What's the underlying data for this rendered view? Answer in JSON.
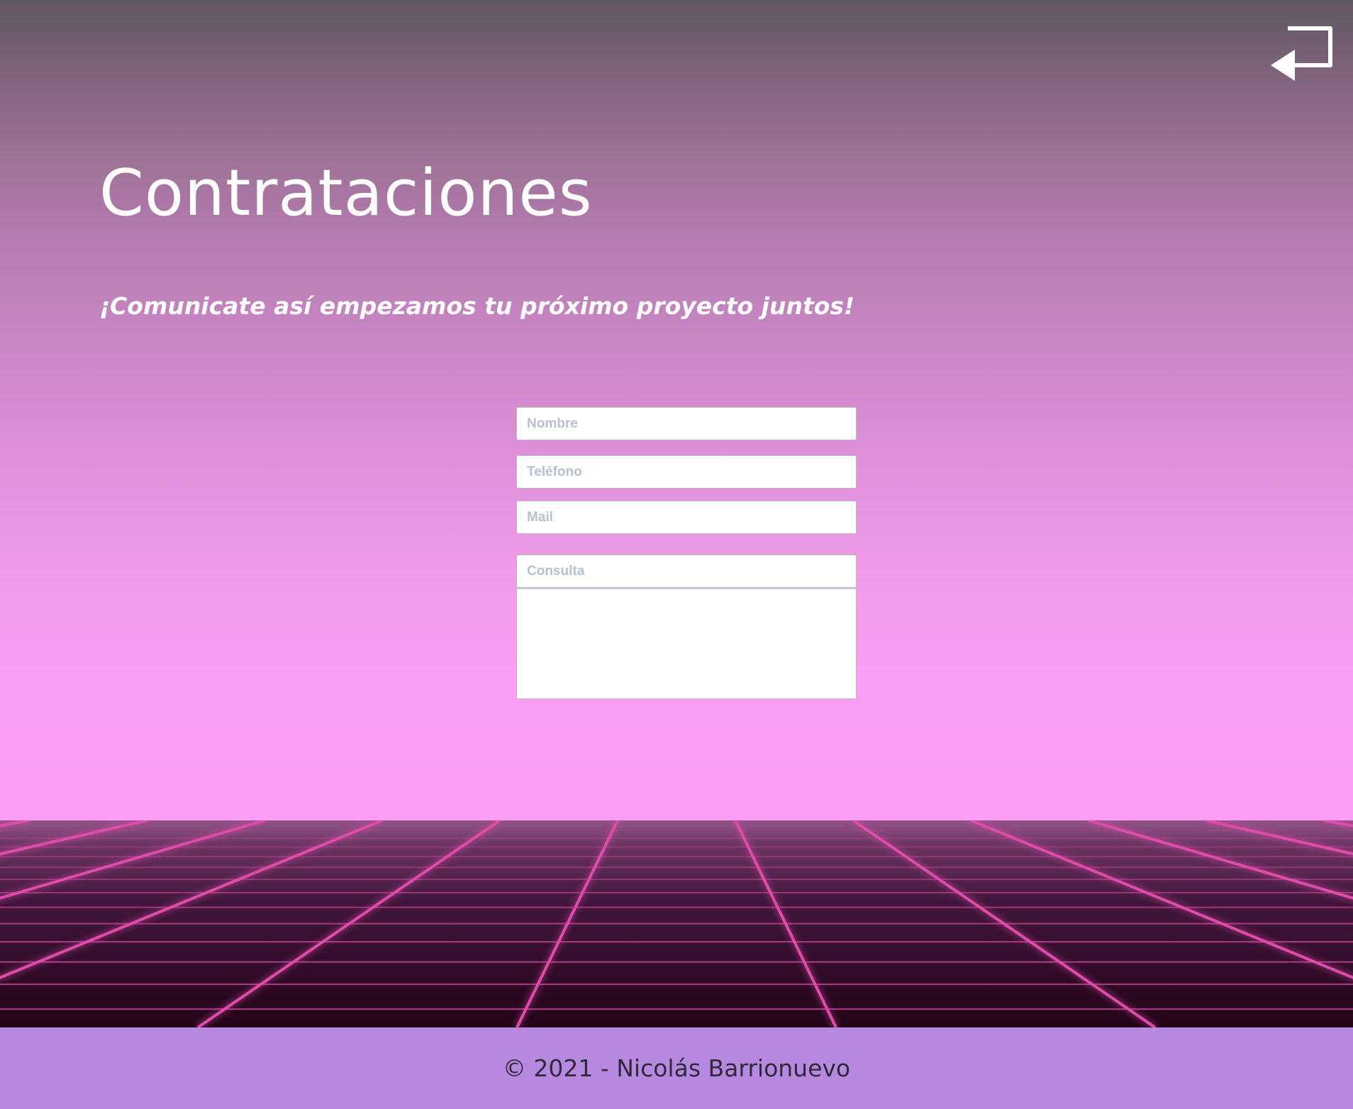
{
  "header": {
    "title": "Contrataciones",
    "subtitle": "¡Comunicate así empezamos tu próximo proyecto juntos!",
    "return_icon": "return-arrow-icon"
  },
  "form": {
    "nombre_placeholder": "Nombre",
    "telefono_placeholder": "Teléfono",
    "mail_placeholder": "Mail",
    "consulta_placeholder": "Consulta"
  },
  "footer": {
    "copyright": "© 2021 - Nicolás Barrionuevo"
  },
  "colors": {
    "sky_top": "#5e5961",
    "sky_bottom": "#fc9ef5",
    "grid_line": "#d44aa8",
    "footer_bg": "#b788e0"
  }
}
